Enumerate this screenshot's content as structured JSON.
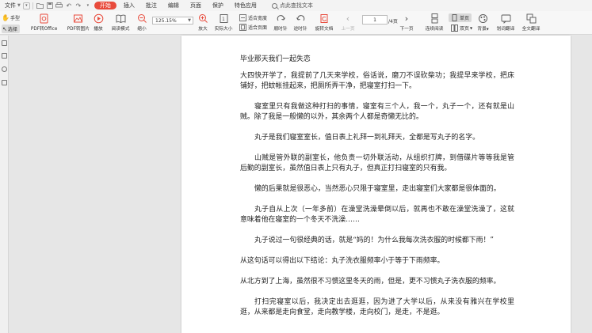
{
  "menubar": {
    "file_label": "文件",
    "tabs": [
      "开始",
      "插入",
      "批注",
      "编辑",
      "页面",
      "保护",
      "特色应用"
    ],
    "active_tab": "开始",
    "search_label": "点此查找文本"
  },
  "ribbon": {
    "hand_tool": "手型",
    "select_tool": "选择",
    "pdf_to_office": "PDF转Office",
    "pdf_to_image": "PDF转图片",
    "play": "播放",
    "reading_mode": "阅读模式",
    "zoom_out": "缩小",
    "zoom_value": "125.15%",
    "zoom_in": "放大",
    "actual_size": "实际大小",
    "fit_width": "适合宽度",
    "fit_page": "适合页面",
    "rotate_cw": "顺时针",
    "rotate_ccw": "逆时针",
    "rotate_doc": "旋转文档",
    "prev_page": "上一页",
    "page_current": "1",
    "page_total": "/4页",
    "next_page": "下一页",
    "continuous_read": "连续阅读",
    "single_page": "单页",
    "double_page": "双页",
    "background": "背景",
    "word_translate": "划词翻译",
    "full_translate": "全文翻译"
  },
  "document": {
    "title": "毕业那天我们一起失恋",
    "paragraphs": [
      "大四快开学了，我提前了几天来学校，俗话说，磨刀不误砍柴功；我提早来学校，把床铺好，把蚊帐挂起来，把厕所弄干净，把寝室打扫一下。",
      "寝室里只有我做这种打扫的事情，寝室有三个人，我一个，丸子一个，还有就是山贼。除了我是一般懒的以外，其余两个人都是奇懒无比的。",
      "丸子是我们寝室室长，值日表上礼拜一到礼拜天，全都是写丸子的名字。",
      "山贼是管外联的副室长，他负责一切外联活动，从组织打牌，到借碟片等等我是管后勤的副室长，虽然值日表上只有丸子，但真正打扫寝室的只有我。",
      "懒的后果就是很恶心，当然恶心只限于寝室里，走出寝室们大家都是很体面的。",
      "丸子自从上次（一年多前）在澡堂洗澡晕倒以后，就再也不敢在澡堂洗澡了，这就意味着他在寝室的一个冬天不洗澡……",
      "丸子说过一句很经典的话，就是“妈的！为什么我每次洗衣服的时候都下雨！”",
      "从这句话可以得出以下结论：丸子洗衣服频率小于等于下雨频率。",
      "从北方到了上海，虽然很不习惯这里冬天的雨，但是，更不习惯丸子洗衣服的频率。",
      "打扫完寝室以后，我决定出去逛逛，因为进了大学以后，从来没有雅兴在学校里逛，从来都是走向食堂，走向教学楼，走向校门，是走，不是逛。"
    ]
  },
  "colors": {
    "accent": "#e84a3b",
    "page_bg": "#ffffff",
    "canvas_bg": "#e6e6e6"
  }
}
